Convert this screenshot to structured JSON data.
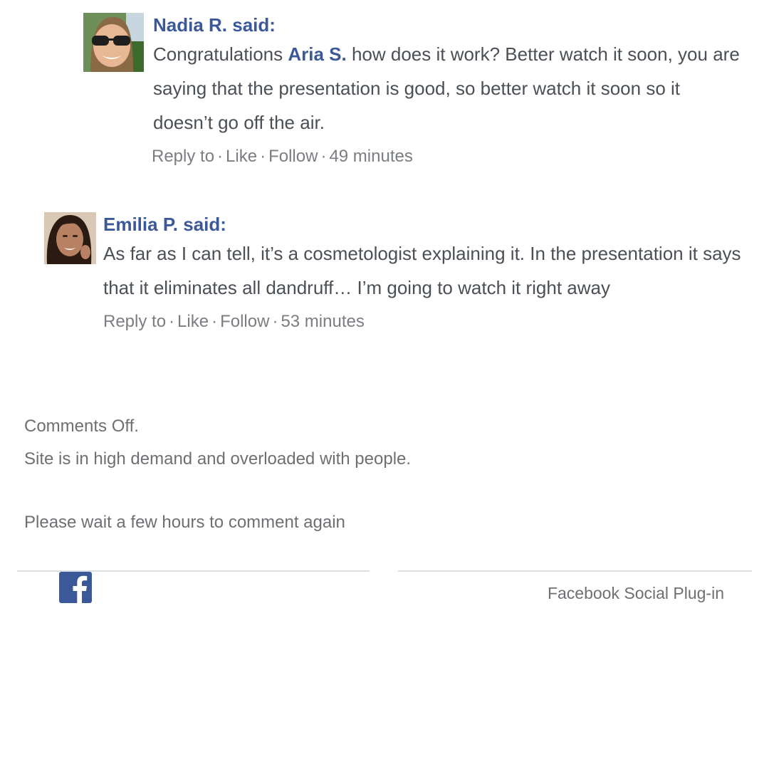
{
  "comments": [
    {
      "author": "Nadia R. said:",
      "text_before": "Congratulations ",
      "mention": "Aria S.",
      "text_after": " how does it work?    Better watch it soon, you are saying that the presentation is good, so better watch it soon so it doesn’t go off the air.",
      "actions": {
        "reply": "Reply to",
        "like": "Like",
        "follow": "Follow",
        "time": "49 minutes"
      },
      "avatar_icon": "avatar-woman-sunglasses"
    },
    {
      "author": "Emilia P. said:",
      "text": "As far as I can tell, it’s a cosmetologist explaining it. In the presentation it says that it eliminates all dandruff… I’m going to watch it right away",
      "actions": {
        "reply": "Reply to",
        "like": "Like",
        "follow": "Follow",
        "time": "53 minutes"
      },
      "avatar_icon": "avatar-woman-dark-hair"
    }
  ],
  "separator": "·",
  "notice": {
    "line1": "Comments Off.",
    "line2": "Site is in high demand and overloaded with people.",
    "line3": "Please wait a few hours to comment again"
  },
  "footer": {
    "icon": "facebook-icon",
    "label": "Facebook Social Plug-in"
  },
  "colors": {
    "author": "#3b5998",
    "text": "#4b4f56",
    "muted": "#7a7d82",
    "facebook": "#3b5998"
  }
}
